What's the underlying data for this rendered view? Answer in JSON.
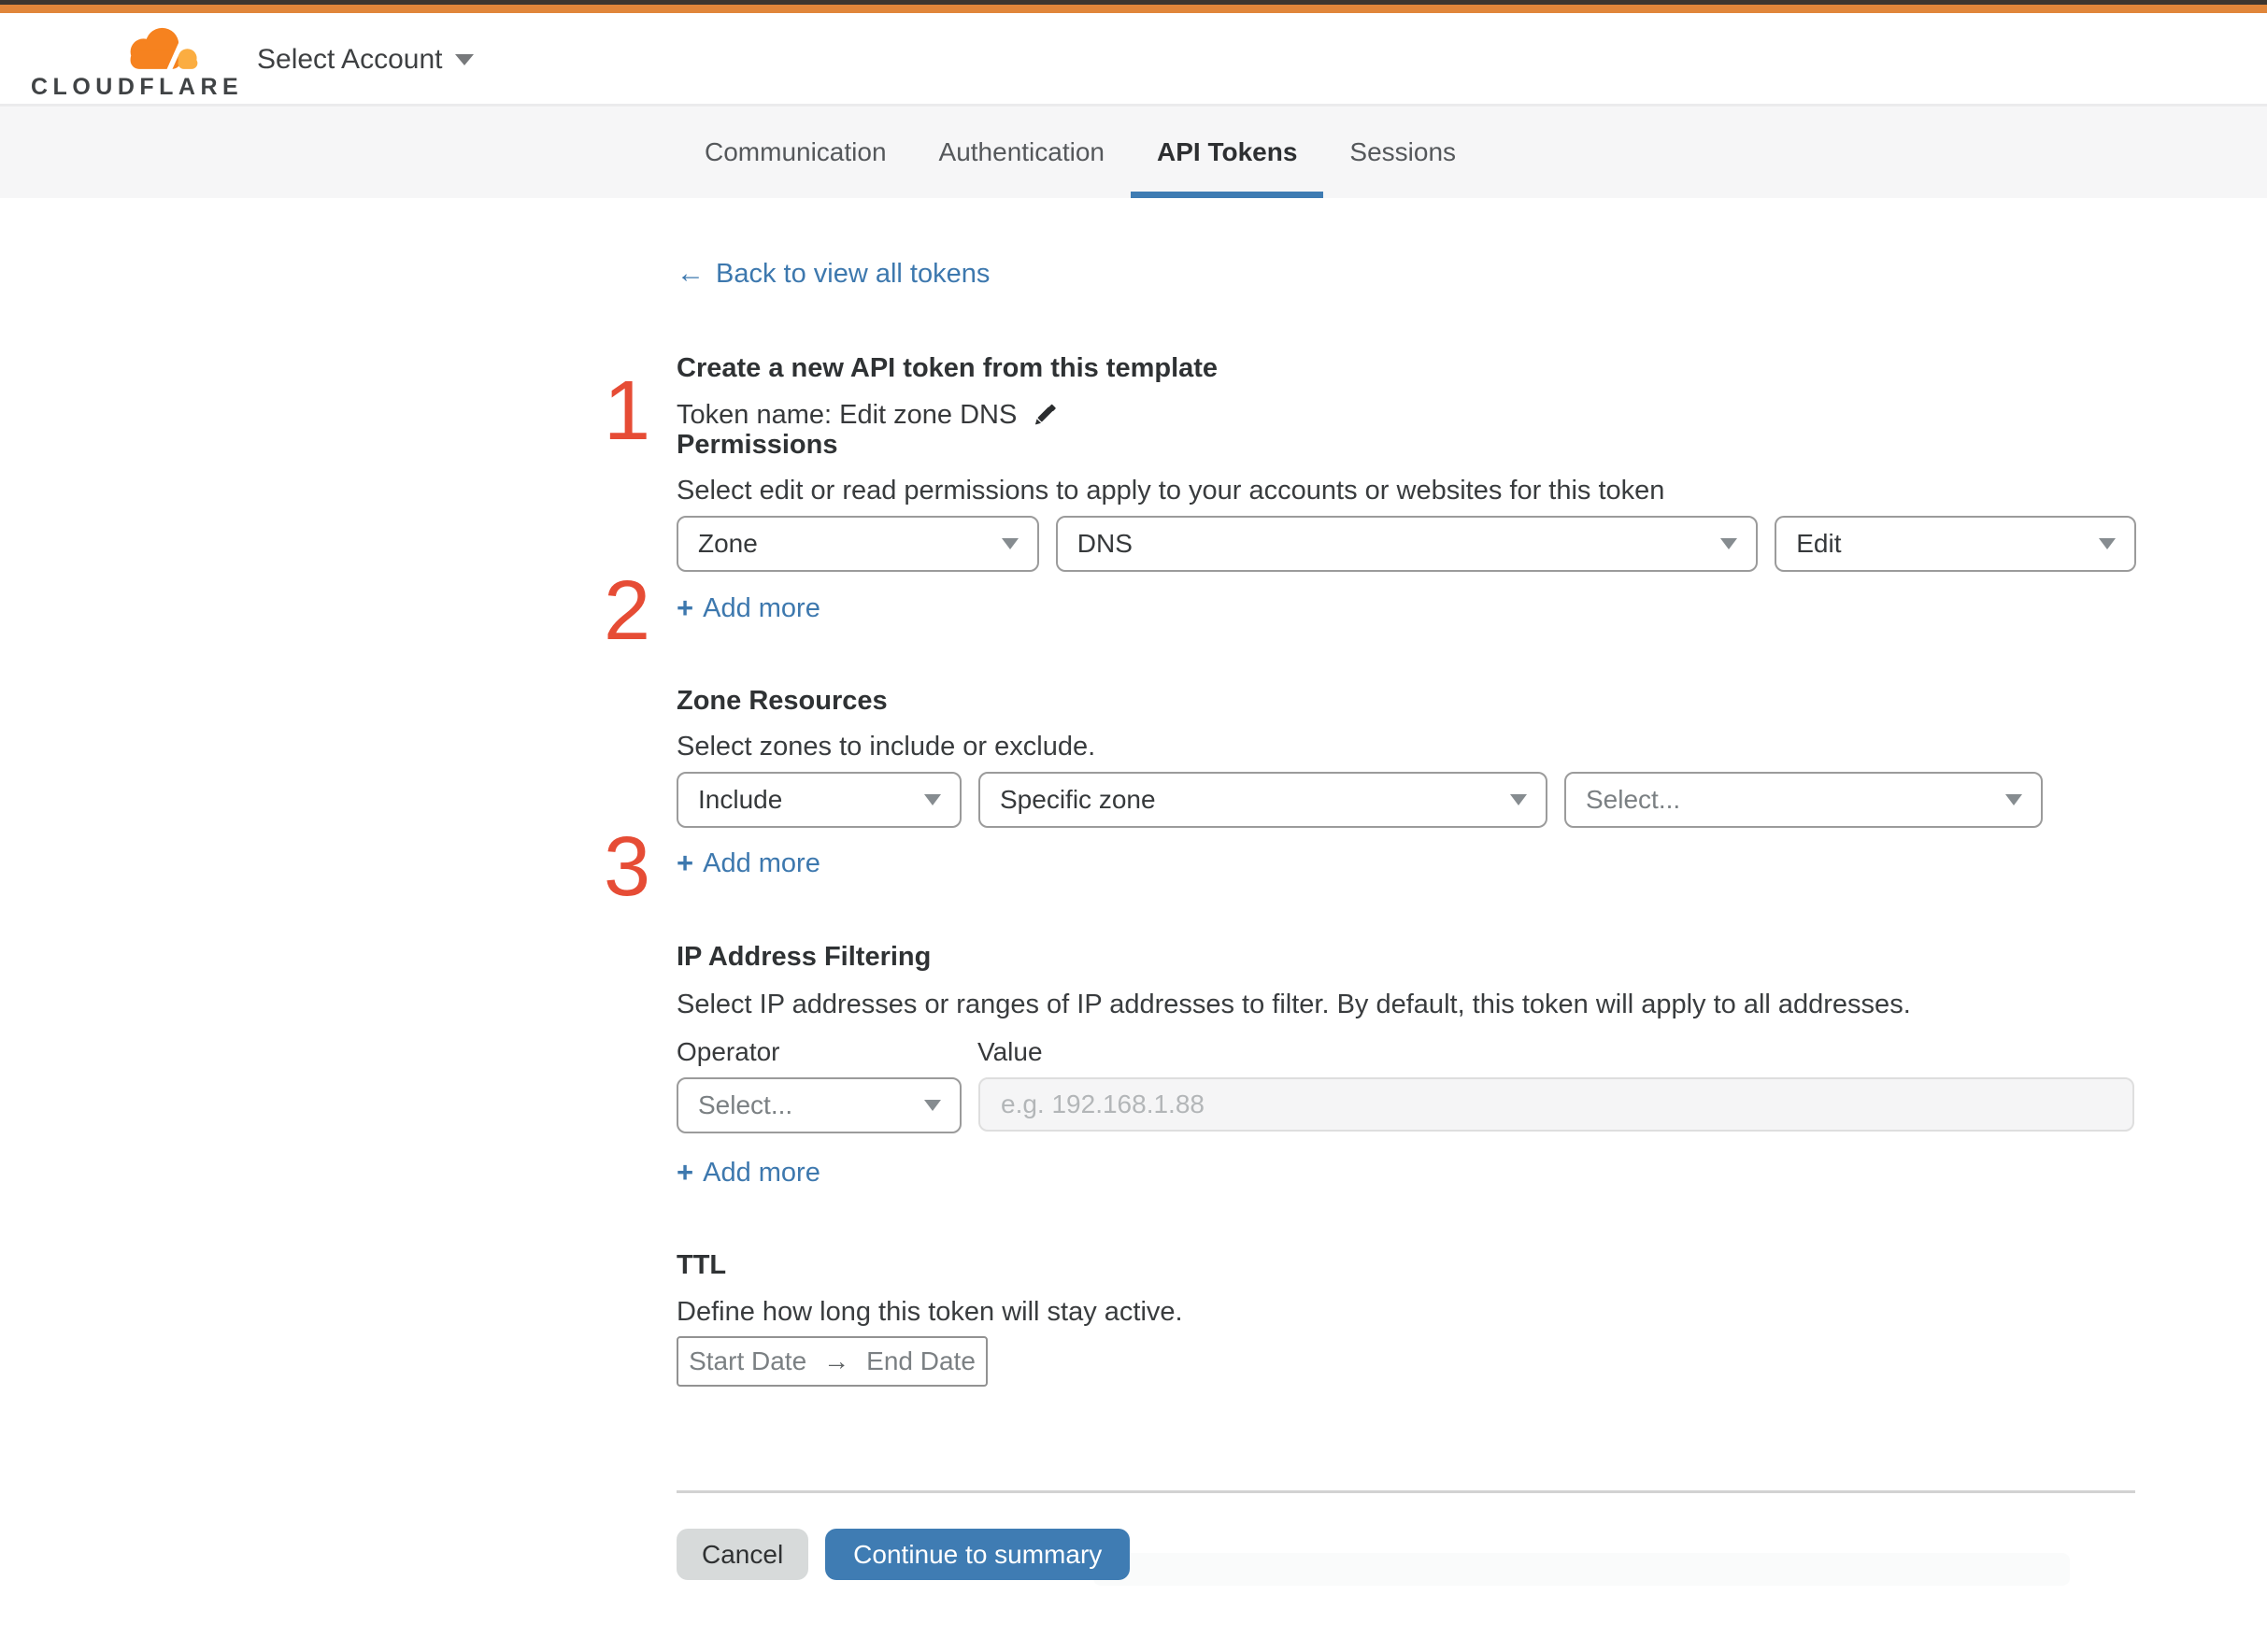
{
  "header": {
    "brand": "CLOUDFLARE",
    "account_selector": "Select Account"
  },
  "tabs": [
    {
      "label": "Communication"
    },
    {
      "label": "Authentication"
    },
    {
      "label": "API Tokens"
    },
    {
      "label": "Sessions"
    }
  ],
  "back_link": {
    "arrow": "←",
    "label": "Back to view all tokens"
  },
  "steps": {
    "s1": "1",
    "s2": "2",
    "s3": "3"
  },
  "token_template": {
    "heading": "Create a new API token from this template",
    "token_name": "Token name: Edit zone DNS"
  },
  "permissions": {
    "heading": "Permissions",
    "description": "Select edit or read permissions to apply to your accounts or websites for this token",
    "scope": "Zone",
    "service": "DNS",
    "access": "Edit",
    "add_more": {
      "plus": "+",
      "label": "Add more"
    }
  },
  "zone_resources": {
    "heading": "Zone Resources",
    "description": "Select zones to include or exclude.",
    "mode": "Include",
    "type": "Specific zone",
    "zone_placeholder": "Select...",
    "add_more": {
      "plus": "+",
      "label": "Add more"
    }
  },
  "ip_filtering": {
    "heading": "IP Address Filtering",
    "description": "Select IP addresses or ranges of IP addresses to filter. By default, this token will apply to all addresses.",
    "operator_label": "Operator",
    "value_label": "Value",
    "operator_placeholder": "Select...",
    "value_placeholder": "e.g. 192.168.1.88",
    "add_more": {
      "plus": "+",
      "label": "Add more"
    }
  },
  "ttl": {
    "heading": "TTL",
    "description": "Define how long this token will stay active.",
    "start_date": "Start Date",
    "arrow": "→",
    "end_date": "End Date"
  },
  "footer": {
    "cancel": "Cancel",
    "continue": "Continue to summary"
  },
  "colors": {
    "accent_orange": "#e0863a",
    "brand_orange": "#f6821f",
    "brand_orange_light": "#fbad41",
    "step_red": "#e64c35",
    "link_blue": "#3d78ae",
    "button_blue": "#3f7cb3",
    "tab_underline": "#3f7cb3"
  }
}
